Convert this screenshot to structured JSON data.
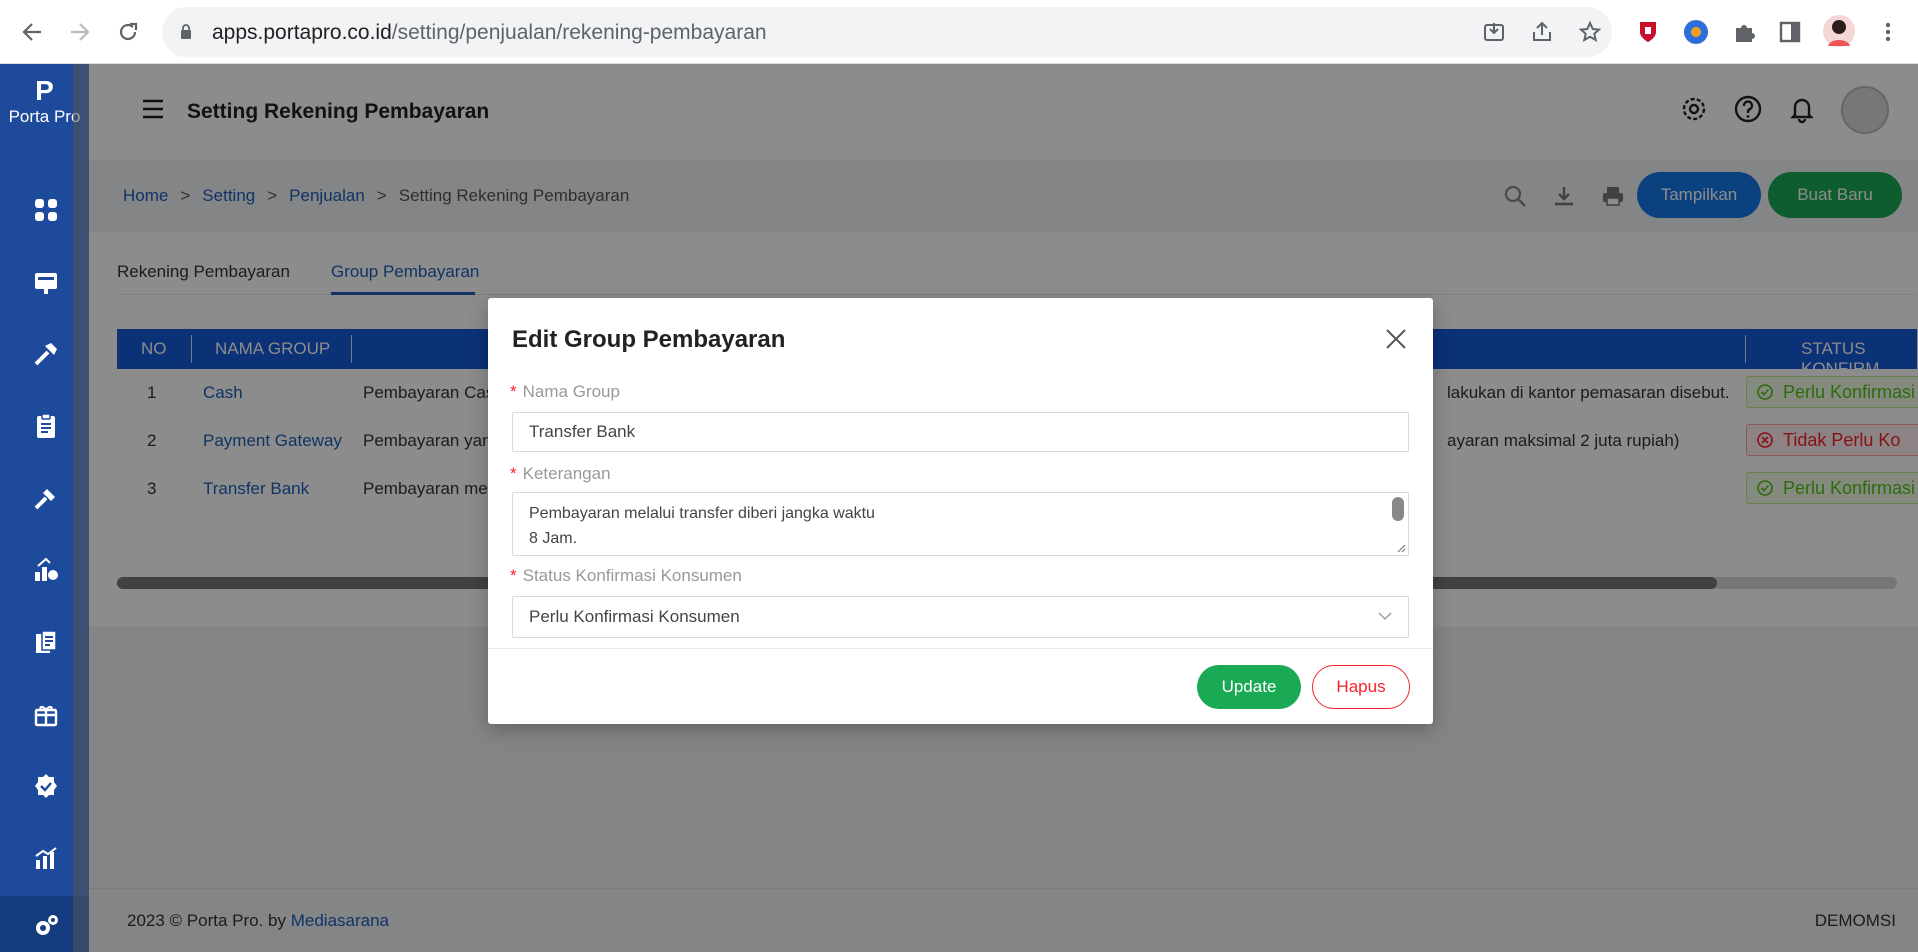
{
  "browser": {
    "url_host": "apps.portapro.co.id",
    "url_path": "/setting/penjualan/rekening-pembayaran"
  },
  "sidebar": {
    "logo_mark": "P",
    "logo_text": "Porta Pro",
    "accent_color": "#1d4a9a"
  },
  "header": {
    "title": "Setting Rekening Pembayaran"
  },
  "breadcrumb": [
    "Home",
    "Setting",
    "Penjualan",
    "Setting Rekening Pembayaran"
  ],
  "toolbar": {
    "tampilkan": "Tampilkan",
    "buat_baru": "Buat Baru"
  },
  "tabs": [
    "Rekening Pembayaran",
    "Group Pembayaran"
  ],
  "table": {
    "headers": [
      "NO",
      "NAMA GROUP",
      "STATUS KONFIRM"
    ],
    "rows": [
      {
        "no": "1",
        "name": "Cash",
        "desc": "Pembayaran Cas",
        "desc_tail": "lakukan di kantor pemasaran disebut.",
        "status": "Perlu Konfirmasi"
      },
      {
        "no": "2",
        "name": "Payment Gateway",
        "desc": "Pembayaran yan",
        "desc_tail": "ayaran maksimal 2 juta rupiah)",
        "status": "Tidak Perlu Ko"
      },
      {
        "no": "3",
        "name": "Transfer Bank",
        "desc": "Pembayaran mel",
        "desc_tail": "",
        "status": "Perlu Konfirmasi"
      }
    ]
  },
  "footer": {
    "copyright": "2023 © Porta Pro. by ",
    "company": "Mediasarana",
    "user": "DEMOMSI"
  },
  "modal": {
    "title": "Edit Group Pembayaran",
    "label_nama": "Nama Group",
    "value_nama": "Transfer Bank",
    "label_keterangan": "Keterangan",
    "keterangan_line1": "Pembayaran melalui transfer diberi jangka waktu",
    "keterangan_line2": "8 Jam.",
    "label_status": "Status Konfirmasi Konsumen",
    "value_status": "Perlu Konfirmasi Konsumen",
    "update": "Update",
    "hapus": "Hapus"
  }
}
